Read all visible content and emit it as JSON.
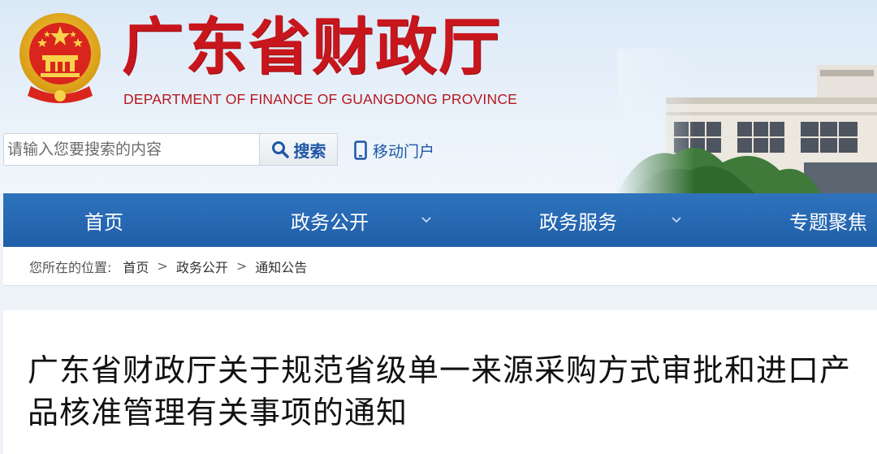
{
  "header": {
    "title": "广东省财政厅",
    "subtitle": "DEPARTMENT OF FINANCE OF GUANGDONG PROVINCE"
  },
  "search": {
    "placeholder": "请输入您要搜索的内容",
    "button_label": "搜索"
  },
  "mobile": {
    "label": "移动门户"
  },
  "nav": {
    "items": [
      {
        "label": "首页"
      },
      {
        "label": "政务公开"
      },
      {
        "label": "政务服务"
      },
      {
        "label": "专题聚焦"
      }
    ]
  },
  "breadcrumb": {
    "prefix": "您所在的位置:",
    "items": [
      "首页",
      "政务公开",
      "通知公告"
    ],
    "separator": ">"
  },
  "article": {
    "title": "广东省财政厅关于规范省级单一来源采购方式审批和进口产品核准管理有关事项的通知"
  },
  "colors": {
    "brand_red": "#c8161d",
    "nav_blue": "#1f5ea9",
    "link_blue": "#1d56a7"
  }
}
